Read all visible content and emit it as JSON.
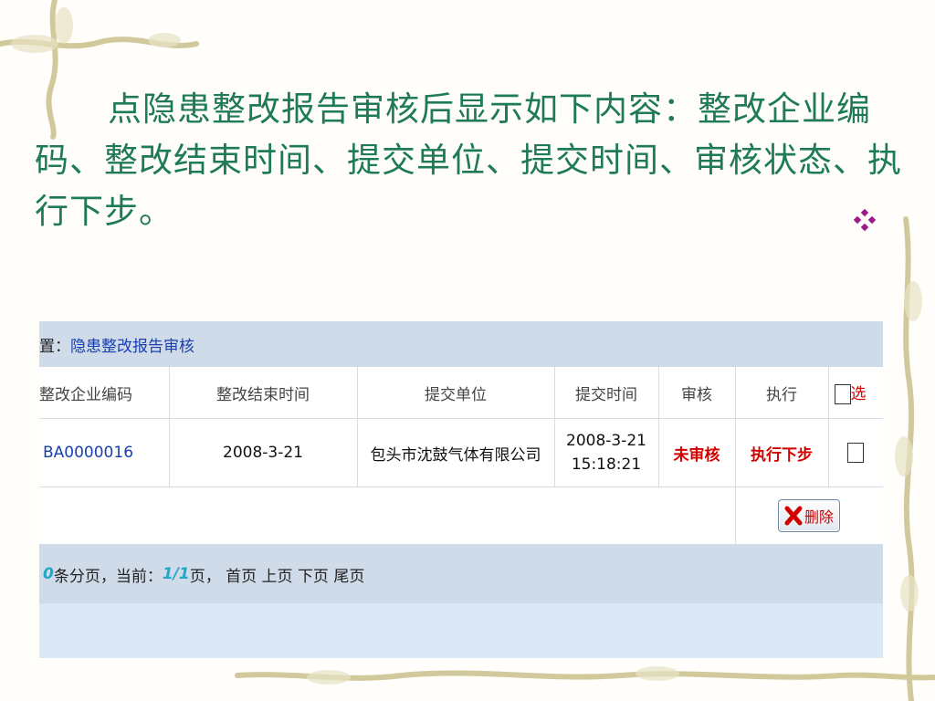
{
  "slide": {
    "instruction": "点隐患整改报告审核后显示如下内容：整改企业编码、整改结束时间、提交单位、提交时间、审核状态、执行下步。"
  },
  "panel": {
    "breadcrumb_prefix": "置：",
    "breadcrumb_link": "隐患整改报告审核",
    "columns": [
      "整改企业编码",
      "整改结束时间",
      "提交单位",
      "提交时间",
      "审核",
      "执行"
    ],
    "select_header": "选",
    "rows": [
      {
        "code": "BA0000016",
        "end_date": "2008-3-21",
        "unit": "包头市沈鼓气体有限公司",
        "submit_date": "2008-3-21",
        "submit_time": "15:18:21",
        "status": "未审核",
        "action": "执行下步"
      }
    ],
    "delete_label": "删除",
    "pager": {
      "count": "0",
      "count_suffix": "条分页，当前：",
      "page": "1/1",
      "page_suffix": "页，",
      "first": "首页",
      "prev": "上页",
      "next": "下页",
      "last": "尾页"
    }
  },
  "colors": {
    "text_green": "#1f7a5a",
    "header_band": "#cfdbe8",
    "status_red": "#d40000",
    "link_blue": "#1a3fb0"
  }
}
